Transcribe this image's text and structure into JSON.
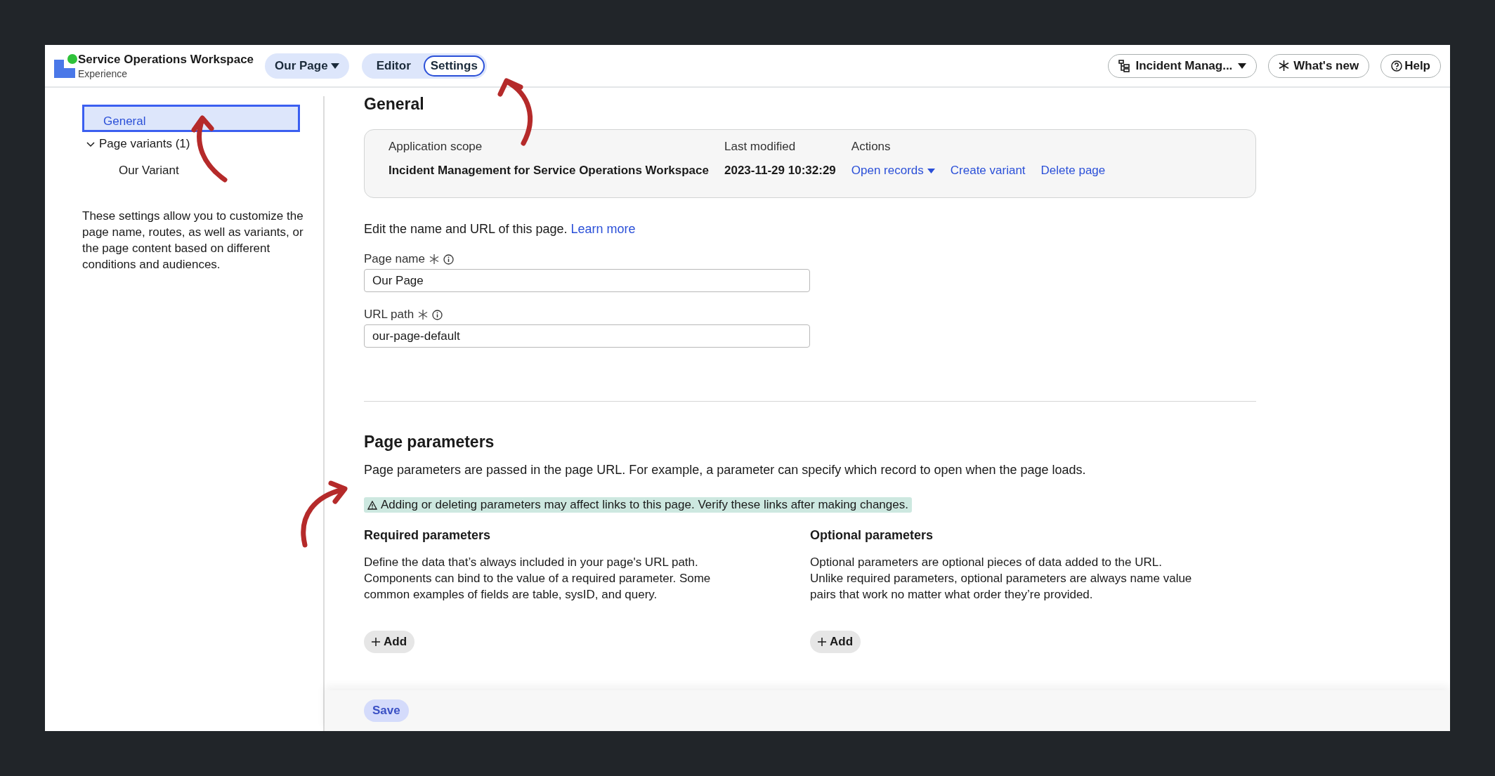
{
  "header": {
    "app_title": "Service Operations Workspace",
    "app_subtitle": "Experience",
    "page_menu": {
      "label": "Our Page"
    },
    "mode_tabs": [
      {
        "label": "Editor",
        "selected": false
      },
      {
        "label": "Settings",
        "selected": true
      }
    ],
    "scope_menu": {
      "label": "Incident Manag..."
    },
    "whats_new": {
      "label": "What's new"
    },
    "help": {
      "label": "Help"
    }
  },
  "sidebar": {
    "items": [
      {
        "label": "General",
        "selected": true
      },
      {
        "label": "Page variants (1)",
        "selected": false,
        "expanded": true,
        "children": [
          {
            "label": "Our Variant",
            "selected": false
          }
        ]
      }
    ],
    "description": "These settings allow you to customize the page name, routes, as well as variants, or the page content based on different conditions and audiences."
  },
  "general": {
    "heading": "General",
    "info_card": {
      "columns": [
        {
          "label": "Application scope",
          "value": "Incident Management for Service Operations Workspace"
        },
        {
          "label": "Last modified",
          "value": "2023-11-29 10:32:29"
        }
      ],
      "actions_label": "Actions",
      "actions": [
        {
          "label": "Open records",
          "kind": "dropdown"
        },
        {
          "label": "Create variant",
          "kind": "link"
        },
        {
          "label": "Delete page",
          "kind": "link"
        }
      ]
    },
    "intro": "Edit the name and URL of this page.",
    "intro_link": "Learn more",
    "fields": [
      {
        "label": "Page name",
        "required": true,
        "value": "Our Page"
      },
      {
        "label": "URL path",
        "required": true,
        "value": "our-page-default"
      }
    ]
  },
  "parameters": {
    "heading": "Page parameters",
    "description": "Page parameters are passed in the page URL. For example, a parameter can specify which record to open when the page loads.",
    "warning": "Adding or deleting parameters may affect links to this page. Verify these links after making changes.",
    "groups": [
      {
        "title": "Required parameters",
        "description": "Define the data that’s always included in your page's URL path. Components can bind to the value of a required parameter. Some common examples of fields are table, sysID, and query.",
        "add_label": "Add"
      },
      {
        "title": "Optional parameters",
        "description": "Optional parameters are optional pieces of data added to the URL. Unlike required parameters, optional parameters are always name value pairs that work no matter what order they’re provided.",
        "add_label": "Add"
      }
    ]
  },
  "footer": {
    "save": {
      "label": "Save",
      "disabled": true
    }
  }
}
